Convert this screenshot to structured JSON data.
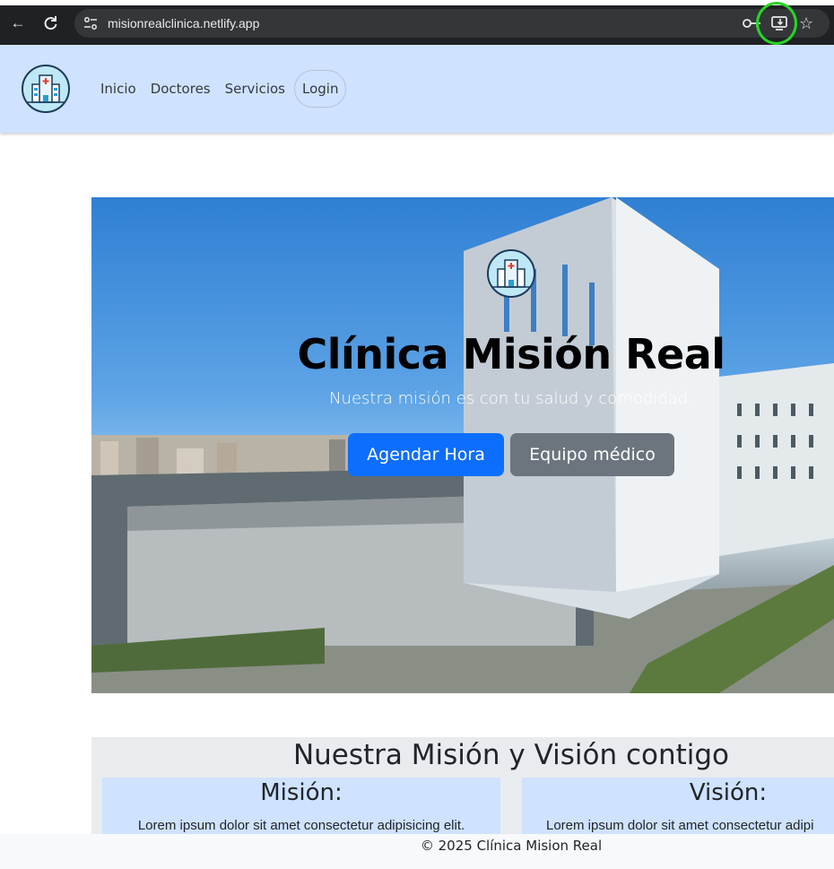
{
  "browser": {
    "url": "misionrealclinica.netlify.app",
    "icons": [
      "back-icon",
      "reload-icon",
      "site-settings-icon",
      "password-key-icon",
      "install-app-icon",
      "bookmark-star-icon"
    ]
  },
  "nav": {
    "items": [
      {
        "label": "Inicio"
      },
      {
        "label": "Doctores"
      },
      {
        "label": "Servicios"
      }
    ],
    "login_label": "Login"
  },
  "hero": {
    "title": "Clínica Misión Real",
    "subtitle": "Nuestra misión es con tu salud y comodidad.",
    "primary_button": "Agendar Hora",
    "secondary_button": "Equipo médico"
  },
  "mission": {
    "title": "Nuestra Misión y Visión contigo",
    "cards": [
      {
        "heading": "Misión:",
        "text": "Lorem ipsum dolor sit amet consectetur adipisicing elit."
      },
      {
        "heading": "Visión:",
        "text": "Lorem ipsum dolor sit amet consectetur adipi"
      }
    ]
  },
  "footer": {
    "text": "© 2025 Clínica Mision Real"
  },
  "colors": {
    "navbar_bg": "#cfe2ff",
    "primary": "#0d6efd",
    "secondary": "#6c757d",
    "highlight_ring": "#26d626"
  }
}
